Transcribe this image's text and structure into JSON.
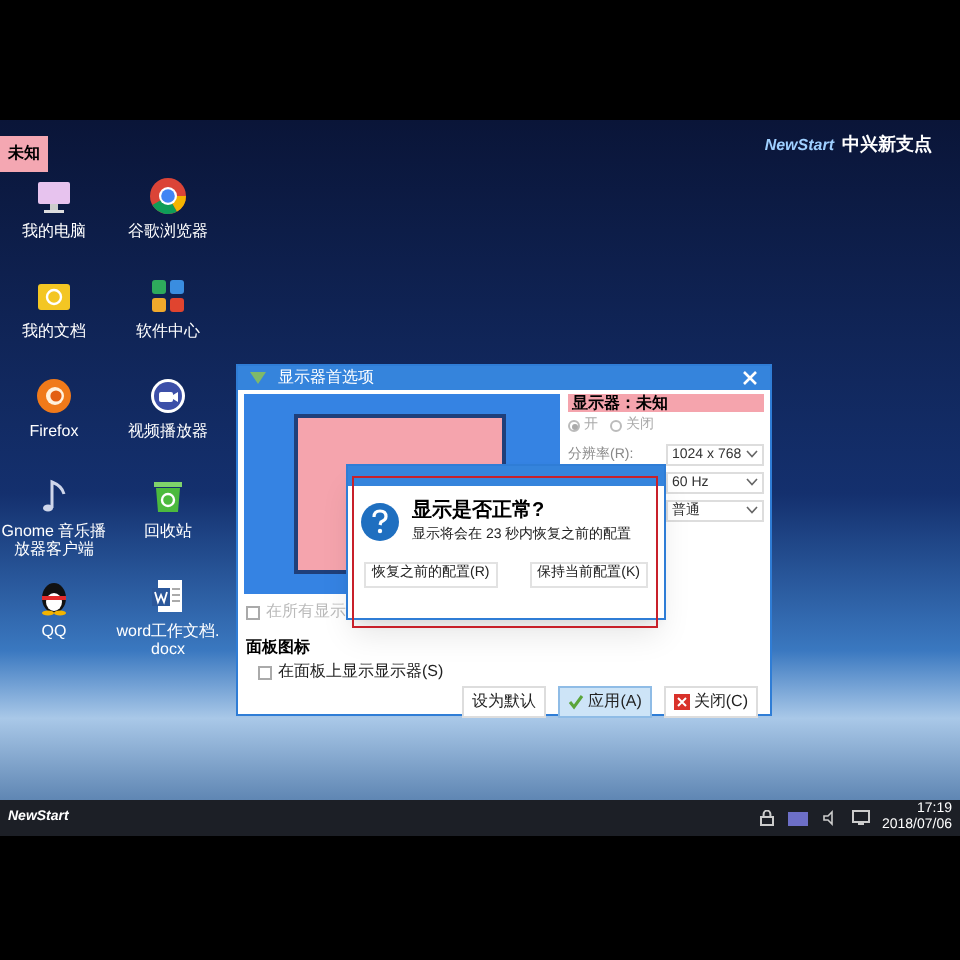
{
  "display_tag": "未知",
  "logo": {
    "brand": "NewStart",
    "name": "中兴新支点"
  },
  "desktop_icons": [
    {
      "label": "我的电脑",
      "kind": "computer"
    },
    {
      "label": "谷歌浏览器",
      "kind": "chrome"
    },
    {
      "label": "我的文档",
      "kind": "folder"
    },
    {
      "label": "软件中心",
      "kind": "apps"
    },
    {
      "label": "Firefox",
      "kind": "firefox"
    },
    {
      "label": "视频播放器",
      "kind": "video"
    },
    {
      "label": "Gnome 音乐播放器客户端",
      "kind": "music"
    },
    {
      "label": "回收站",
      "kind": "trash"
    },
    {
      "label": "QQ",
      "kind": "penguin"
    },
    {
      "label": "word工作文档.docx",
      "kind": "document"
    }
  ],
  "display_window": {
    "title": "显示器首选项",
    "monitor_label": "显示器：未知",
    "radios": [
      {
        "label": "开",
        "selected": true
      },
      {
        "label": "关闭",
        "selected": false
      }
    ],
    "resolution_label": "分辨率(R):",
    "resolution": "1024 x 768",
    "refresh": "60 Hz",
    "rotation": "普通",
    "mirror_checkbox": {
      "label": "在所有显示",
      "checked": false
    },
    "panel_heading": "面板图标",
    "panel_checkbox": {
      "label": "在面板上显示显示器(S)",
      "checked": false
    },
    "buttons": [
      {
        "label": "设为默认",
        "kind": "plain"
      },
      {
        "label": "应用(A)",
        "kind": "apply"
      },
      {
        "label": "关闭(C)",
        "kind": "close"
      }
    ]
  },
  "confirm_dialog": {
    "heading": "显示是否正常?",
    "message": "显示将会在 23 秒内恢复之前的配置",
    "buttons": [
      "恢复之前的配置(R)",
      "保持当前配置(K)"
    ]
  },
  "taskbar": {
    "start": "NewStart",
    "time": "17:19",
    "date": "2018/07/06"
  }
}
